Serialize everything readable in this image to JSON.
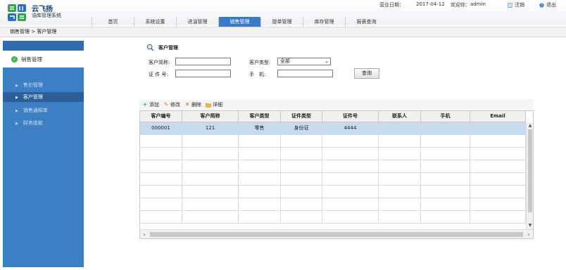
{
  "brand": {
    "name": "云飞扬",
    "subtitle": "油库管理系统"
  },
  "header": {
    "date_label": "营业日期：",
    "date_value": "2017-04-12",
    "welcome_label": "欢迎你：",
    "user": "admin",
    "logout_label": "注销",
    "exit_label": "退出"
  },
  "nav": {
    "tabs": [
      {
        "label": "首页"
      },
      {
        "label": "系统设置"
      },
      {
        "label": "进油管理"
      },
      {
        "label": "销售管理",
        "active": true
      },
      {
        "label": "提单管理"
      },
      {
        "label": "库存管理"
      },
      {
        "label": "报表查询"
      }
    ]
  },
  "breadcrumb": "销售管理 > 客户管理",
  "sidebar": {
    "main_label": "销售管理",
    "items": [
      {
        "label": "售价管理"
      },
      {
        "label": "客户管理",
        "active": true
      },
      {
        "label": "销售通知单"
      },
      {
        "label": "财务收款"
      }
    ]
  },
  "content": {
    "title": "客户管理",
    "form": {
      "name_label": "客户简称:",
      "name_value": "",
      "type_label": "客户类型:",
      "type_value": "全部",
      "idno_label": "证 件 号:",
      "idno_value": "",
      "phone_label": "手　机:",
      "phone_value": "",
      "search_label": "查询"
    },
    "toolbar": {
      "add": "添加",
      "edit": "修改",
      "delete": "删除",
      "detail": "详细"
    },
    "table": {
      "columns": [
        "客户编号",
        "客户简称",
        "客户类型",
        "证件类型",
        "证件号",
        "联系人",
        "手机",
        "Email"
      ],
      "rows": [
        [
          "000001",
          "121",
          "零售",
          "身份证",
          "4444",
          "",
          "",
          ""
        ]
      ]
    }
  },
  "colors": {
    "accent": "#3b78c6",
    "sidebar": "#3c7fc4",
    "selected_row": "#c5dbef"
  }
}
